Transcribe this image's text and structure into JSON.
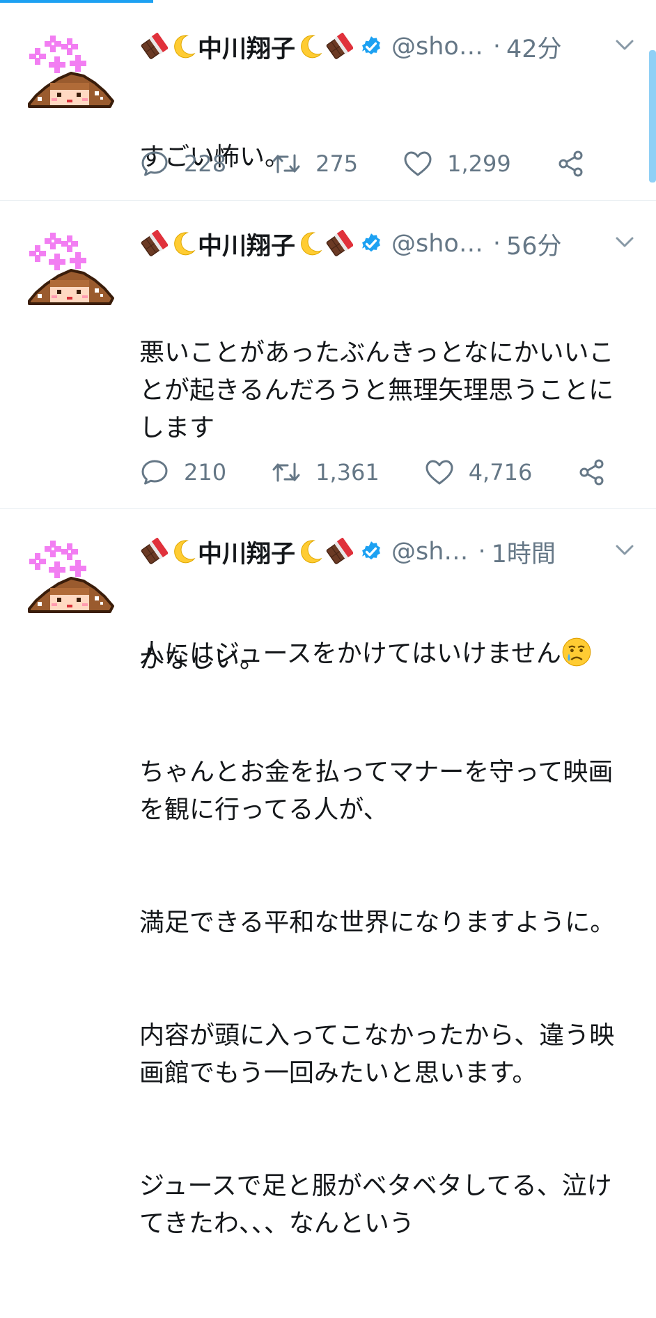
{
  "tweets": [
    {
      "name": "中川翔子",
      "handle": "@sho…",
      "time": "42分",
      "text_paragraphs": [
        "すごい怖い。"
      ],
      "reply_count": "228",
      "retweet_count": "275",
      "like_count": "1,299"
    },
    {
      "name": "中川翔子",
      "handle": "@sho…",
      "time": "56分",
      "text_paragraphs": [
        "悪いことがあったぶんきっとなにかいいことが起きるんだろうと無理矢理思うことにします",
        "",
        "人にはジュースをかけてはいけません"
      ],
      "reply_count": "210",
      "retweet_count": "1,361",
      "like_count": "4,716"
    },
    {
      "name": "中川翔子",
      "handle": "@sh…",
      "time": "1時間",
      "text_paragraphs": [
        "かなしい。",
        "ちゃんとお金を払ってマナーを守って映画を観に行ってる人が、",
        "満足できる平和な世界になりますように。",
        "内容が頭に入ってこなかったから、違う映画館でもう一回みたいと思います。",
        "ジュースで足と服がベタベタしてる、泣けてきたわ、、、なんという"
      ],
      "reply_count": "",
      "retweet_count": "",
      "like_count": ""
    }
  ],
  "colors": {
    "accent": "#1da1f2",
    "muted": "#657786",
    "text": "#14171a",
    "divider": "#e6ecf0"
  },
  "icons": {
    "name_emoji": [
      "chocolate-icon",
      "crescent-moon-icon"
    ],
    "verified": "verified-badge-icon",
    "reply": "reply-icon",
    "retweet": "retweet-icon",
    "like": "heart-icon",
    "share": "share-icon",
    "caret": "chevron-down-icon",
    "text_emoji": "crying-face-emoji"
  }
}
